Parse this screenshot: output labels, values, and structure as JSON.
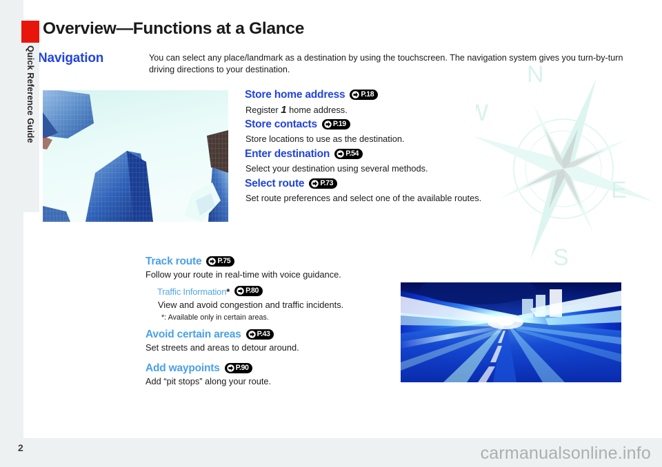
{
  "document": {
    "page_title": "Overview—Functions at a Glance",
    "page_number": "2",
    "watermark": "carmanualsonline.info",
    "side_tab_label": "Quick Reference Guide",
    "accent_red": "#e8150d",
    "heading_blue_dark": "#2244dd",
    "heading_blue_light": "#4ba0e8"
  },
  "section": {
    "heading": "Navigation",
    "intro": "You can select any place/landmark as a destination by using the touchscreen. The navigation system gives you turn-by-turn driving directions to your destination."
  },
  "features_top": [
    {
      "title": "Store home address",
      "page_ref": "P.18",
      "desc_pre": "Register ",
      "desc_emphasis": "1",
      "desc_post": " home address."
    },
    {
      "title": "Store contacts",
      "page_ref": "P.19",
      "desc": "Store locations to use as the destination."
    },
    {
      "title": "Enter destination",
      "page_ref": "P.54",
      "desc": "Select your destination using several methods."
    },
    {
      "title": "Select route",
      "page_ref": "P.73",
      "desc": "Set route preferences and select one of the available routes."
    }
  ],
  "features_bottom": [
    {
      "title": "Track route",
      "page_ref": "P.75",
      "desc": "Follow your route in real-time with voice guidance."
    },
    {
      "title": "Traffic Information",
      "title_mark": "*",
      "page_ref": "P.80",
      "desc": "View and avoid congestion and traffic incidents.",
      "footnote": "*: Available only in certain areas."
    },
    {
      "title": "Avoid certain areas",
      "page_ref": "P.43",
      "desc": "Set streets and areas to detour around."
    },
    {
      "title": "Add waypoints",
      "page_ref": "P.90",
      "desc": "Add “pit stops” along your route."
    }
  ],
  "images": {
    "city_photo_alt": "skyscrapers-photo",
    "tunnel_photo_alt": "motion-blur-road-tunnel-photo",
    "compass_alt": "compass-rose-watermark",
    "compass_letters": {
      "n": "N",
      "e": "E",
      "s": "S",
      "w": "W"
    }
  }
}
